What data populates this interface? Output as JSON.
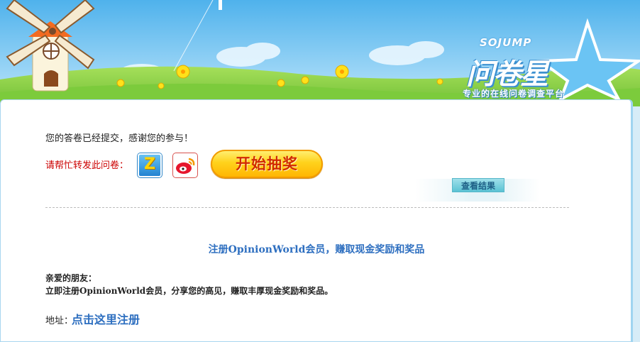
{
  "header": {
    "logo_en": "SOJUMP",
    "logo_cn": "问卷星",
    "tagline": "专业的在线问卷调查平台"
  },
  "content": {
    "thanks_message": "您的答卷已经提交，感谢您的参与！",
    "share_label": "请帮忙转发此问卷：",
    "share_icons": [
      "qzone-icon",
      "weibo-icon"
    ],
    "lottery_button": "开始抽奖",
    "result_button": "查看结果"
  },
  "promo": {
    "title": "注册OpinionWorld会员，赚取现金奖励和奖品",
    "greeting": "亲爱的朋友：",
    "body": "立即注册OpinionWorld会员，分享您的高见，赚取丰厚现金奖励和奖品。",
    "address_label": "地址：",
    "register_link": "点击这里注册"
  },
  "colors": {
    "sky": "#5bb8ee",
    "grass": "#8fd14a",
    "accent_blue": "#2e6fc0",
    "share_red": "#cc0000",
    "lottery_yellow": "#ffd21c"
  }
}
